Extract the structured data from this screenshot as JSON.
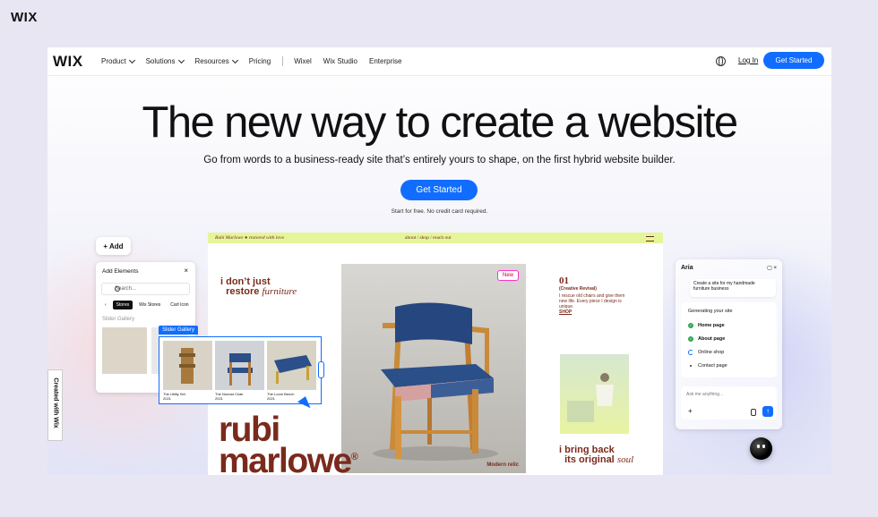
{
  "corner_logo": "WIX",
  "nav": {
    "logo": "WIX",
    "items": [
      {
        "label": "Product",
        "dropdown": true
      },
      {
        "label": "Solutions",
        "dropdown": true
      },
      {
        "label": "Resources",
        "dropdown": true
      },
      {
        "label": "Pricing",
        "dropdown": false
      }
    ],
    "secondary_items": [
      "Wixel",
      "Wix Studio",
      "Enterprise"
    ],
    "globe_icon": "globe-icon",
    "login": "Log In",
    "cta": "Get Started"
  },
  "hero": {
    "headline": "The new way to create a website",
    "subheadline": "Go from words to a business-ready site that’s entirely yours to shape, on the first hybrid website builder.",
    "cta": "Get Started",
    "note": "Start for free. No credit card required."
  },
  "site_mock": {
    "brand": "Rubi Marlowe",
    "tagline": "restored with love",
    "links": "about  /  shop  /  reach out",
    "restore_line1": "i don’t just",
    "restore_line2": "restore",
    "restore_italic": "furniture",
    "new_tag": "New",
    "photo_caption": "Modern relic",
    "big_name_line1": "rubi",
    "big_name_line2": "marlowe",
    "registered": "®",
    "side_number": "01",
    "side_title": "(Creative Revival)",
    "side_text": "I rescue old chairs and give them new life. Every piece I design is unique.",
    "side_shop": "SHOP",
    "bring_line1": "i bring back",
    "bring_line2": "its original",
    "bring_italic": "soul"
  },
  "editor": {
    "add_button": "+ Add",
    "panel_title": "Add Elements",
    "search_placeholder": "Search...",
    "tabs": [
      "Stores",
      "Wix Stores",
      "Cart Icon"
    ],
    "section_label": "Slider Gallery",
    "slider_tag": "Slider Gallery",
    "slider_items": [
      {
        "name": "The Utility Set",
        "sub": "2021",
        "color": "#c8b59a"
      },
      {
        "name": "The Nomad Chair",
        "sub": "2021",
        "color": "#b9c4cf"
      },
      {
        "name": "The Loom Bench",
        "sub": "2021",
        "color": "#d8cba0"
      }
    ],
    "created_with": "Created with Wix"
  },
  "aria": {
    "title": "Aria",
    "prompt": "Create a site for my handmade furniture business",
    "generating_title": "Generating your site",
    "steps": [
      {
        "label": "Home page",
        "state": "done"
      },
      {
        "label": "About page",
        "state": "done"
      },
      {
        "label": "Online shop",
        "state": "in-progress"
      },
      {
        "label": "Contact page",
        "state": "todo"
      }
    ],
    "input_placeholder": "Ask me anything...",
    "plus_icon": "+",
    "send_icon": "↑"
  },
  "colors": {
    "accent": "#116dff",
    "brand_brown": "#7a2a1c",
    "lime": "#e6f59a"
  }
}
